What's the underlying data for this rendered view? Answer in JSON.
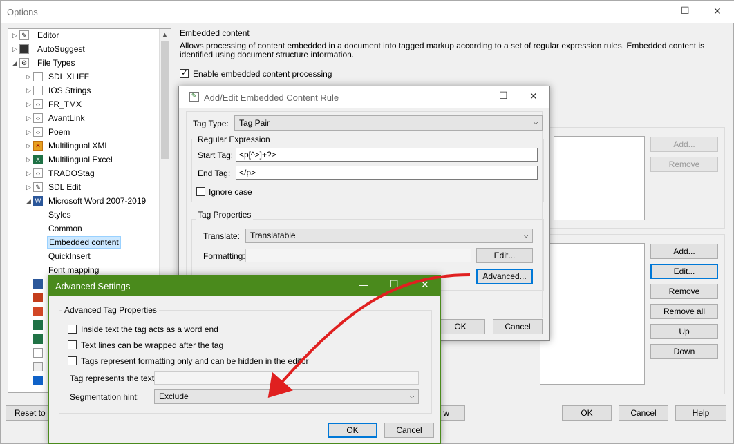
{
  "main": {
    "title": "Options",
    "win_minimize": "—",
    "win_maximize": "☐",
    "win_close": "✕",
    "tree": [
      {
        "label": "Editor"
      },
      {
        "label": "AutoSuggest"
      },
      {
        "label": "File Types"
      },
      {
        "label": "SDL XLIFF"
      },
      {
        "label": "IOS Strings"
      },
      {
        "label": "FR_TMX"
      },
      {
        "label": "AvantLink"
      },
      {
        "label": "Poem"
      },
      {
        "label": "Multilingual XML"
      },
      {
        "label": "Multilingual Excel"
      },
      {
        "label": "TRADOStag"
      },
      {
        "label": "SDL Edit"
      },
      {
        "label": "Microsoft Word 2007-2019"
      },
      {
        "label": "Styles"
      },
      {
        "label": "Common"
      },
      {
        "label": "Embedded content"
      },
      {
        "label": "QuickInsert"
      },
      {
        "label": "Font mapping"
      }
    ],
    "section_title": "Embedded content",
    "section_desc": "Allows processing of content embedded in a document into tagged markup according to a set of regular expression rules. Embedded content is identified using document structure information.",
    "enable_label": "Enable embedded content processing",
    "enable_checked": true,
    "top_buttons": {
      "add": "Add...",
      "remove": "Remove"
    },
    "right_buttons": {
      "add": "Add...",
      "edit": "Edit...",
      "remove": "Remove",
      "remove_all": "Remove all",
      "up": "Up",
      "down": "Down"
    },
    "footer": {
      "reset": "Reset to D",
      "view": "w",
      "ok": "OK",
      "cancel": "Cancel",
      "help": "Help"
    }
  },
  "rule_dialog": {
    "title": "Add/Edit Embedded Content Rule",
    "tag_type_label": "Tag Type:",
    "tag_type_value": "Tag Pair",
    "regex_group": "Regular Expression",
    "start_tag_label": "Start Tag:",
    "start_tag_value": "<p[^>]+?>",
    "end_tag_label": "End Tag:",
    "end_tag_value": "</p>",
    "ignore_case_label": "Ignore case",
    "tag_props_group": "Tag Properties",
    "translate_label": "Translate:",
    "translate_value": "Translatable",
    "formatting_label": "Formatting:",
    "edit_button": "Edit...",
    "advanced_button": "Advanced...",
    "ok": "OK",
    "cancel": "Cancel"
  },
  "advanced_dialog": {
    "title": "Advanced Settings",
    "title_bar_color": "#4a8a1c",
    "group": "Advanced Tag Properties",
    "opt1": "Inside text the tag acts as a word end",
    "opt2": "Text lines can be wrapped after the tag",
    "opt3": "Tags represent formatting only and can be hidden in the editor",
    "tag_text_label": "Tag represents the text:",
    "tag_text_value": "",
    "seg_hint_label": "Segmentation hint:",
    "seg_hint_value": "Exclude",
    "ok": "OK",
    "cancel": "Cancel"
  },
  "annotation": {
    "arrow_color": "#e02020"
  }
}
